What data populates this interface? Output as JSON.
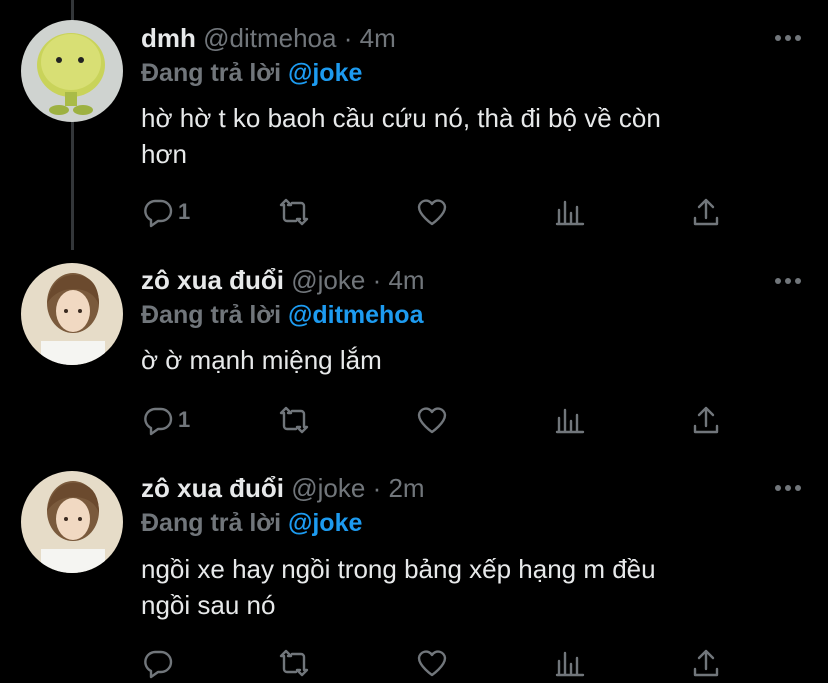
{
  "tweets": [
    {
      "name": "dmh",
      "handle": "@ditmehoa",
      "dot": "·",
      "time": "4m",
      "reply_prefix": "Đang trả lời",
      "reply_to": "@joke",
      "text_lines": [
        "hờ hờ t ko baoh cầu cứu nó, thà đi bộ về còn",
        "hơn"
      ],
      "reply_count": "1"
    },
    {
      "name": "zô xua đuổi",
      "handle": "@joke",
      "dot": "·",
      "time": "4m",
      "reply_prefix": "Đang trả lời",
      "reply_to": "@ditmehoa",
      "text_lines": [
        "ờ ờ mạnh miệng lắm"
      ],
      "reply_count": "1"
    },
    {
      "name": "zô xua đuổi",
      "handle": "@joke",
      "dot": "·",
      "time": "2m",
      "reply_prefix": "Đang trả lời",
      "reply_to": "@joke",
      "text_lines": [
        "ngồi xe hay ngồi trong bảng xếp hạng m đều",
        "ngồi sau nó"
      ],
      "reply_count": ""
    }
  ],
  "icons": {
    "reply": "reply-icon",
    "retweet": "retweet-icon",
    "like": "like-icon",
    "views": "views-icon",
    "share": "share-icon",
    "more": "more-options-icon"
  },
  "colors": {
    "background": "#000000",
    "text": "#e7e9ea",
    "muted": "#71767b",
    "accent": "#1d9bf0"
  }
}
